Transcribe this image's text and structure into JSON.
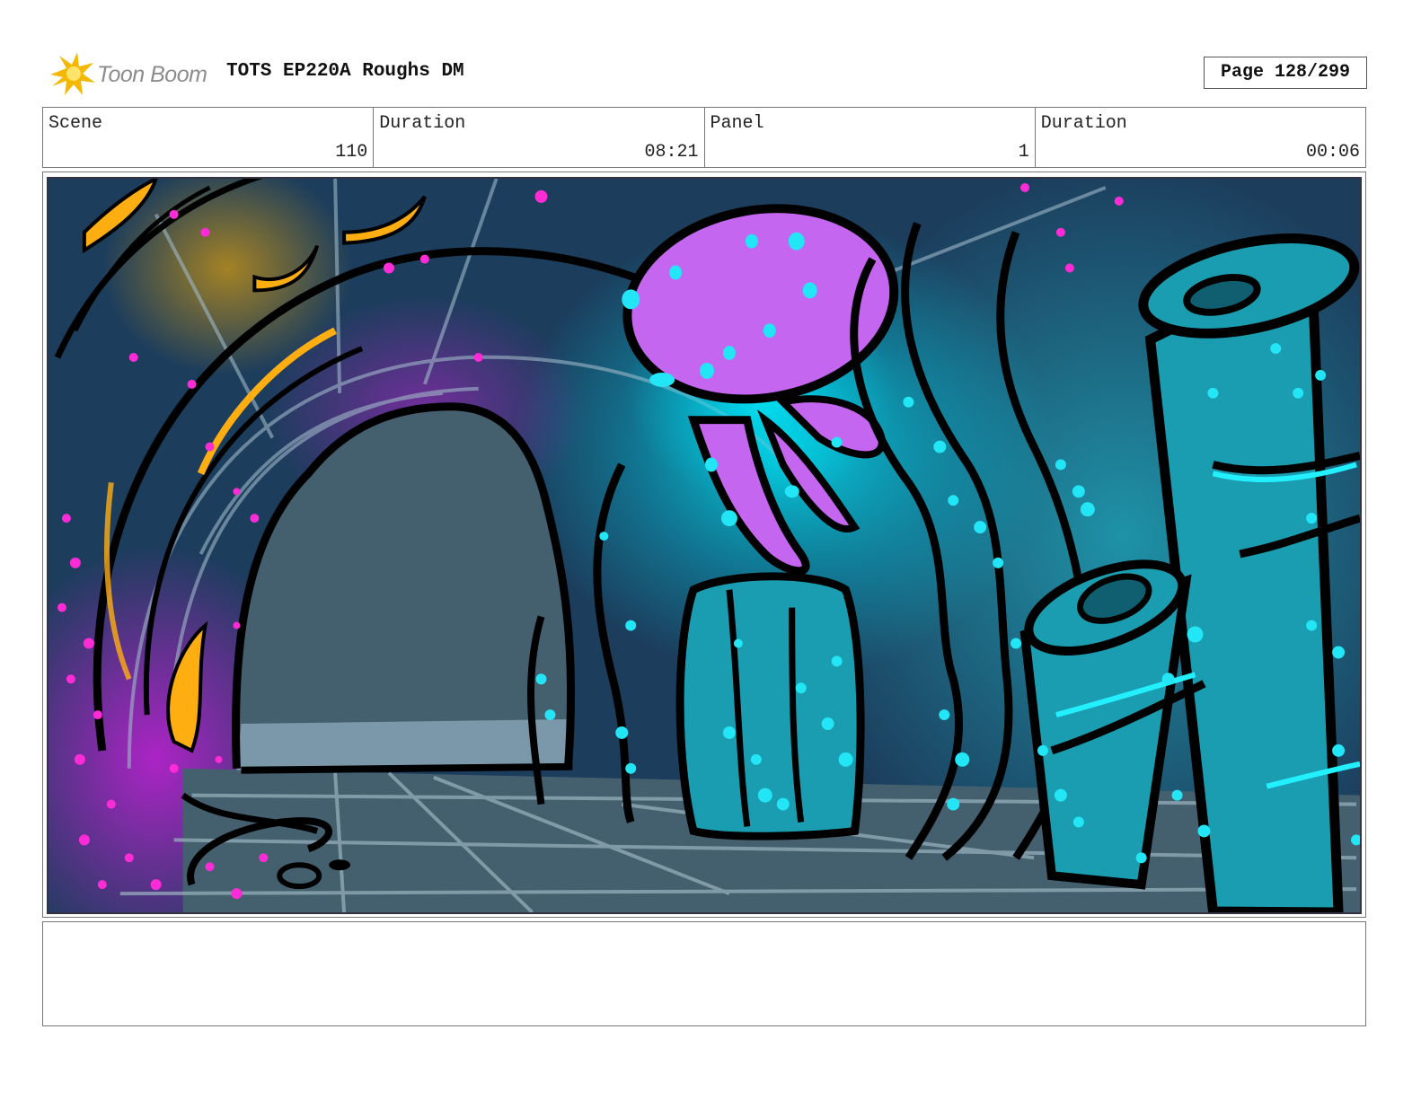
{
  "header": {
    "logo_text": "Toon Boom",
    "project_title": "TOTS EP220A Roughs DM",
    "page_label": "Page 128/299"
  },
  "info": {
    "scene_label": "Scene",
    "scene_value": "110",
    "duration_label": "Duration",
    "duration_value": "08:21",
    "panel_label": "Panel",
    "panel_value": "1",
    "panel_duration_label": "Duration",
    "panel_duration_value": "00:06"
  },
  "colors": {
    "accent_logo": "#f5b800",
    "water_dark": "#1b3f5e",
    "glow_cyan": "#00e6f0",
    "jelly_purple": "#c466f0",
    "spark_magenta": "#ff2bd6",
    "kelp_teal": "#1a9db0"
  },
  "notes": {
    "text": ""
  }
}
